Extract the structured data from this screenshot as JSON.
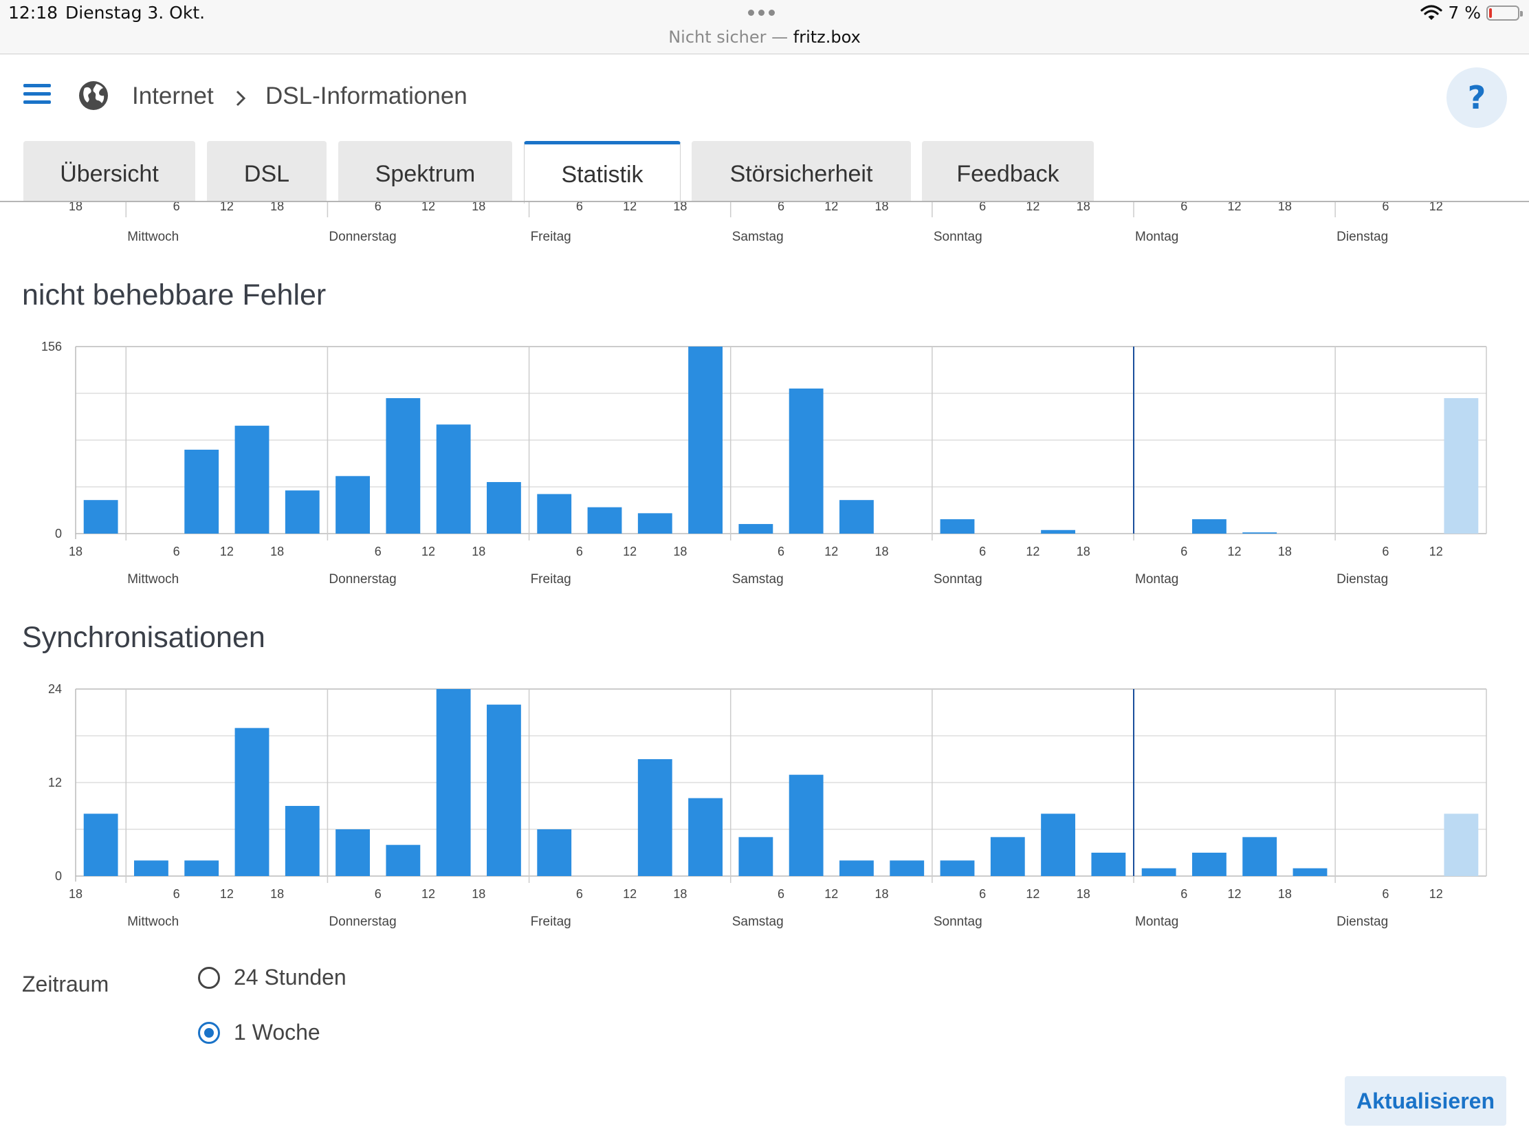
{
  "status_bar": {
    "time": "12:18",
    "date": "Dienstag 3. Okt.",
    "url_prefix": "Nicht sicher —",
    "url_host": "fritz.box",
    "battery": "7 %",
    "battery_level": 0.07
  },
  "header": {
    "breadcrumb_1": "Internet",
    "breadcrumb_2": "DSL-Informationen",
    "help": "?"
  },
  "tabs": [
    "Übersicht",
    "DSL",
    "Spektrum",
    "Statistik",
    "Störsicherheit",
    "Feedback"
  ],
  "active_tab": "Statistik",
  "top_axis": {
    "hour_ticks": [
      [
        "18"
      ],
      [
        "6",
        "12",
        "18"
      ],
      [
        "6",
        "12",
        "18"
      ],
      [
        "6",
        "12",
        "18"
      ],
      [
        "6",
        "12",
        "18"
      ],
      [
        "6",
        "12",
        "18"
      ],
      [
        "6",
        "12",
        "18"
      ],
      [
        "6",
        "12"
      ]
    ],
    "days": [
      "Mittwoch",
      "Donnerstag",
      "Freitag",
      "Samstag",
      "Sonntag",
      "Montag",
      "Dienstag"
    ]
  },
  "chart_data": [
    {
      "type": "bar",
      "title": "nicht behebbare Fehler",
      "ylim": [
        0,
        156
      ],
      "ytick_labels": [
        "0",
        "156"
      ],
      "days": [
        "Mittwoch",
        "Donnerstag",
        "Freitag",
        "Samstag",
        "Sonntag",
        "Montag",
        "Dienstag"
      ],
      "hour_ticks": [
        [
          "18"
        ],
        [
          "6",
          "12",
          "18"
        ],
        [
          "6",
          "12",
          "18"
        ],
        [
          "6",
          "12",
          "18"
        ],
        [
          "6",
          "12",
          "18"
        ],
        [
          "6",
          "12",
          "18"
        ],
        [
          "6",
          "12",
          "18"
        ],
        [
          "6",
          "12"
        ]
      ],
      "values": [
        28,
        0,
        70,
        90,
        36,
        48,
        113,
        91,
        43,
        33,
        22,
        17,
        156,
        8,
        121,
        28,
        0,
        12,
        0,
        3,
        0,
        0,
        12,
        1,
        0,
        0,
        0,
        113
      ],
      "current_value": 113
    },
    {
      "type": "bar",
      "title": "Synchronisationen",
      "ylim": [
        0,
        24
      ],
      "ytick_labels": [
        "0",
        "12",
        "24"
      ],
      "days": [
        "Mittwoch",
        "Donnerstag",
        "Freitag",
        "Samstag",
        "Sonntag",
        "Montag",
        "Dienstag"
      ],
      "hour_ticks": [
        [
          "18"
        ],
        [
          "6",
          "12",
          "18"
        ],
        [
          "6",
          "12",
          "18"
        ],
        [
          "6",
          "12",
          "18"
        ],
        [
          "6",
          "12",
          "18"
        ],
        [
          "6",
          "12",
          "18"
        ],
        [
          "6",
          "12",
          "18"
        ],
        [
          "6",
          "12"
        ]
      ],
      "values": [
        8,
        2,
        2,
        19,
        9,
        6,
        4,
        24,
        22,
        6,
        0,
        15,
        10,
        5,
        13,
        2,
        2,
        2,
        5,
        8,
        3,
        1,
        3,
        5,
        1,
        0,
        0,
        8
      ],
      "current_value": 8
    }
  ],
  "colors": {
    "bar": "#2a8de0",
    "bar_current": "#bcdaf3",
    "accent": "#1a73c8",
    "grid": "#dddddd"
  },
  "zeitraum": {
    "label": "Zeitraum",
    "options": [
      "24 Stunden",
      "1 Woche"
    ],
    "selected": "1 Woche"
  },
  "refresh_label": "Aktualisieren"
}
